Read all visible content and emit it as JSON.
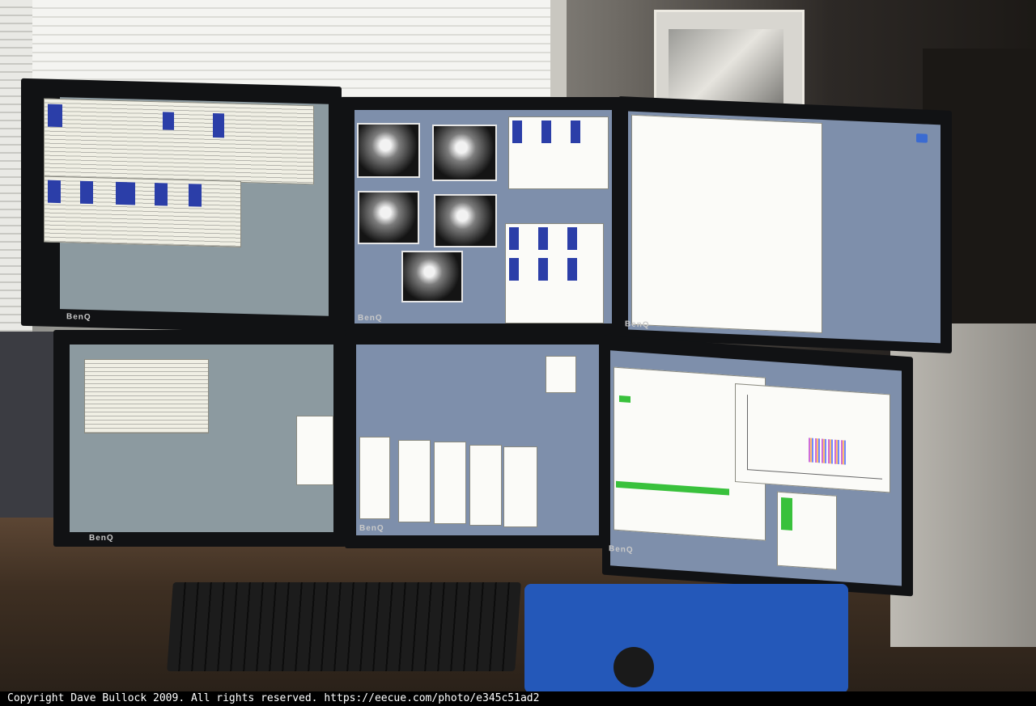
{
  "scene": {
    "description_free": true,
    "monitor_brand": "BenQ",
    "colors": {
      "desktop": "#7e8fab",
      "selection": "#2b3ea8",
      "status_green": "#39c13c",
      "mousepad": "#2458b9"
    }
  },
  "monitors": [
    {
      "id": "top-left",
      "brand": "BenQ"
    },
    {
      "id": "top-center",
      "brand": "BenQ"
    },
    {
      "id": "top-right",
      "brand": "BenQ"
    },
    {
      "id": "bottom-left",
      "brand": "BenQ"
    },
    {
      "id": "bottom-center",
      "brand": "BenQ"
    },
    {
      "id": "bottom-right",
      "brand": "BenQ"
    }
  ],
  "desktop_icons": [
    "folder-icon"
  ],
  "footer": {
    "copyright": "Copyright Dave Bullock 2009. All rights reserved. https://eecue.com/photo/e345c51ad2"
  }
}
